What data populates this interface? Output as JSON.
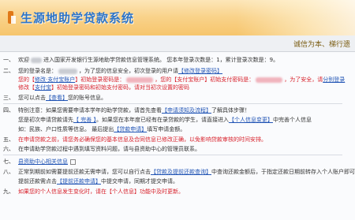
{
  "header": {
    "title": "生源地助学贷款系统"
  },
  "welcome": {
    "text": "诚信为本、梯行遗"
  },
  "lines": [
    {
      "num": "一、",
      "a": "欢迎",
      "b": "进入国家开发银行生源地助学贷款信息管理系统。 您本年登录次数是：1，累计登录次数是：9。"
    },
    {
      "num": "二、",
      "a": "您的登录名是：",
      "b": "，为了您的信息安全，初次登录的用户请",
      "c": "【修改登录密码】"
    },
    {
      "num": "",
      "a": "您的【",
      "b": "修改·支付宝账户",
      "c": "】初始登录密码是：",
      "d": "，您的",
      "e": "【支付宝账户】初始支付密码是：",
      "f": "，为了安全，请",
      "g": "分别登录"
    },
    {
      "num": "",
      "a": "修改【",
      "b": "支付宝",
      "c": "】初始登录密码和",
      "d": "初始支付密码，请对当",
      "e": "初次设置的密码"
    },
    {
      "num": "三、",
      "a": "您可以点击",
      "b": "【查看】",
      "c": "您的账号信息。"
    },
    {
      "num": "四、",
      "a": "特别注意：如果您需要申请本学年的助学贷款，请首先查看",
      "b": "【申请须知及流程】",
      "c": "了解具体步骤！"
    },
    {
      "num": "",
      "a": "您是初次申请贷款请先",
      "b": "【 完善 】",
      "c": "。如果您在本年度已经有在录贷款的学生，请直接进入",
      "d": "【个人信息变更】",
      "e": "中完善个人信息"
    },
    {
      "num": "",
      "a": "如：民族、户口性质等信息。 最后提出",
      "b": "【贷款申请】",
      "c": "填写申请金额。"
    },
    {
      "num": "五、",
      "a": "在申请贷款之前，请您务必确保您的基本信息及合同信息已修改正确，以免影响贷款审核的时间安排。",
      "b": "",
      "c": ""
    },
    {
      "num": "六、",
      "a": "在申请助学贷款过程中遇到填写资料问题，请与县资助中心的管理员联系。",
      "b": "",
      "c": ""
    },
    {
      "num": "七、",
      "a": "县资助中心相关信息",
      "b": "",
      "c": ""
    },
    {
      "num": "八、",
      "a": "正常到期前如需要提前还款无需申请，您可以自行点击",
      "b": "【贷款及提前还款查询】",
      "c": "中查询还款金额后，于指定还款日期前转存入个人账户即可。"
    },
    {
      "num": "",
      "a": "提前还款需点击",
      "b": "【提前还款申请】",
      "c": "中提交申请，同期才提交申请。"
    },
    {
      "num": "九、",
      "a": "如果您的个人信息发生变化时，请在",
      "b": "【个人信息】",
      "c": "功能中及时更新。"
    }
  ]
}
